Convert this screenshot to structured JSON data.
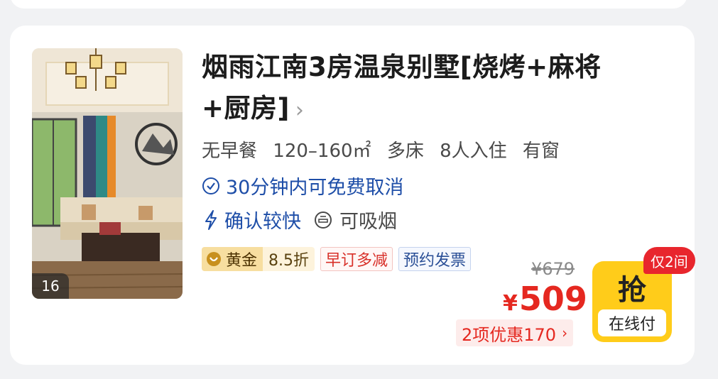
{
  "room": {
    "photo_count": "16",
    "title": "烟雨江南3房温泉别墅[烧烤+麻将+厨房]",
    "title_chevron": "›",
    "specs": {
      "breakfast": "无早餐",
      "area": "120–160㎡",
      "bed": "多床",
      "occupancy": "8人入住",
      "window": "有窗"
    },
    "cancel_policy": "30分钟内可免费取消",
    "confirm_speed": "确认较快",
    "smoking": "可吸烟",
    "tags": {
      "gold_level": "黄金",
      "gold_discount": "8.5折",
      "early_booking": "早订多减",
      "invoice": "预约发票"
    },
    "original_price": "¥679",
    "currency": "¥",
    "price": "509",
    "discount_summary": "2项优惠170",
    "discount_arrow": "›",
    "book_button": "抢",
    "payment_type": "在线付",
    "scarcity_badge": "仅2间"
  },
  "colors": {
    "price_red": "#e52820",
    "link_blue": "#1e4ea8",
    "button_yellow": "#ffcc1a",
    "gold_tag": "#f7dea0"
  },
  "icons": {
    "cancel": "check-circle-icon",
    "confirm": "lightning-icon",
    "smoking": "smoking-icon",
    "gold": "heart-badge-icon"
  }
}
